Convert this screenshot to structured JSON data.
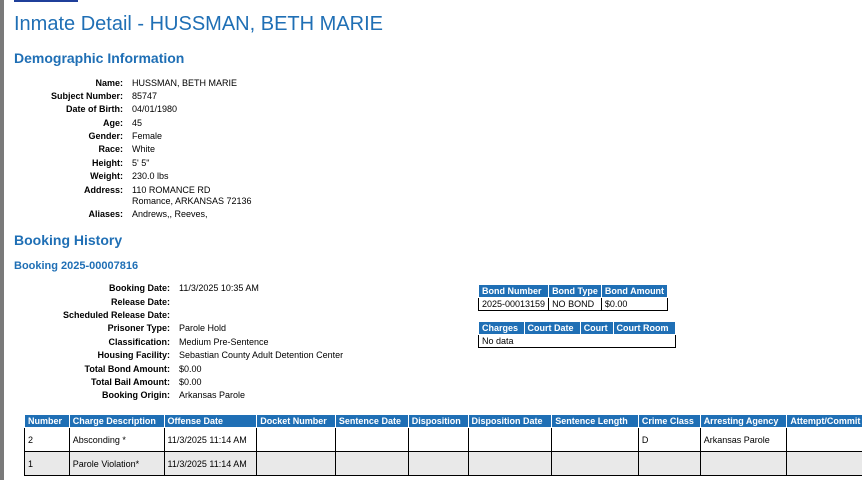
{
  "page": {
    "title": "Inmate Detail - HUSSMAN, BETH MARIE"
  },
  "demographics": {
    "heading": "Demographic Information",
    "fields": [
      {
        "label": "Name:",
        "value": "HUSSMAN, BETH MARIE"
      },
      {
        "label": "Subject Number:",
        "value": "85747"
      },
      {
        "label": "Date of Birth:",
        "value": "04/01/1980"
      },
      {
        "label": "Age:",
        "value": "45"
      },
      {
        "label": "Gender:",
        "value": "Female"
      },
      {
        "label": "Race:",
        "value": "White"
      },
      {
        "label": "Height:",
        "value": "5' 5\""
      },
      {
        "label": "Weight:",
        "value": "230.0 lbs"
      },
      {
        "label": "Address:",
        "value": "110 ROMANCE RD",
        "value2": "Romance, ARKANSAS 72136"
      },
      {
        "label": "Aliases:",
        "value": "Andrews,, Reeves,"
      }
    ]
  },
  "booking_history": {
    "heading": "Booking History",
    "booking": {
      "title": "Booking 2025-00007816",
      "fields": [
        {
          "label": "Booking Date:",
          "value": "11/3/2025 10:35 AM"
        },
        {
          "label": "Release Date:",
          "value": ""
        },
        {
          "label": "Scheduled Release Date:",
          "value": ""
        },
        {
          "label": "Prisoner Type:",
          "value": "Parole Hold"
        },
        {
          "label": "Classification:",
          "value": "Medium Pre-Sentence"
        },
        {
          "label": "Housing Facility:",
          "value": "Sebastian County Adult Detention Center"
        },
        {
          "label": "Total Bond Amount:",
          "value": "$0.00"
        },
        {
          "label": "Total Bail Amount:",
          "value": "$0.00"
        },
        {
          "label": "Booking Origin:",
          "value": "Arkansas Parole"
        }
      ],
      "bond_table": {
        "headers": [
          "Bond Number",
          "Bond Type",
          "Bond Amount"
        ],
        "rows": [
          [
            "2025-00013159",
            "NO BOND",
            "$0.00"
          ]
        ]
      },
      "court_table": {
        "headers": [
          "Charges",
          "Court Date",
          "Court",
          "Court Room"
        ],
        "no_data": "No data"
      },
      "charges_table": {
        "headers": [
          "Number",
          "Charge Description",
          "Offense Date",
          "Docket Number",
          "Sentence Date",
          "Disposition",
          "Disposition Date",
          "Sentence Length",
          "Crime Class",
          "Arresting Agency",
          "Attempt/Commit"
        ],
        "rows": [
          [
            "2",
            "Absconding *",
            "11/3/2025 11:14 AM",
            "",
            "",
            "",
            "",
            "",
            "D",
            "Arkansas Parole",
            ""
          ],
          [
            "1",
            "Parole Violation*",
            "11/3/2025 11:14 AM",
            "",
            "",
            "",
            "",
            "",
            "",
            "",
            ""
          ]
        ]
      }
    }
  }
}
